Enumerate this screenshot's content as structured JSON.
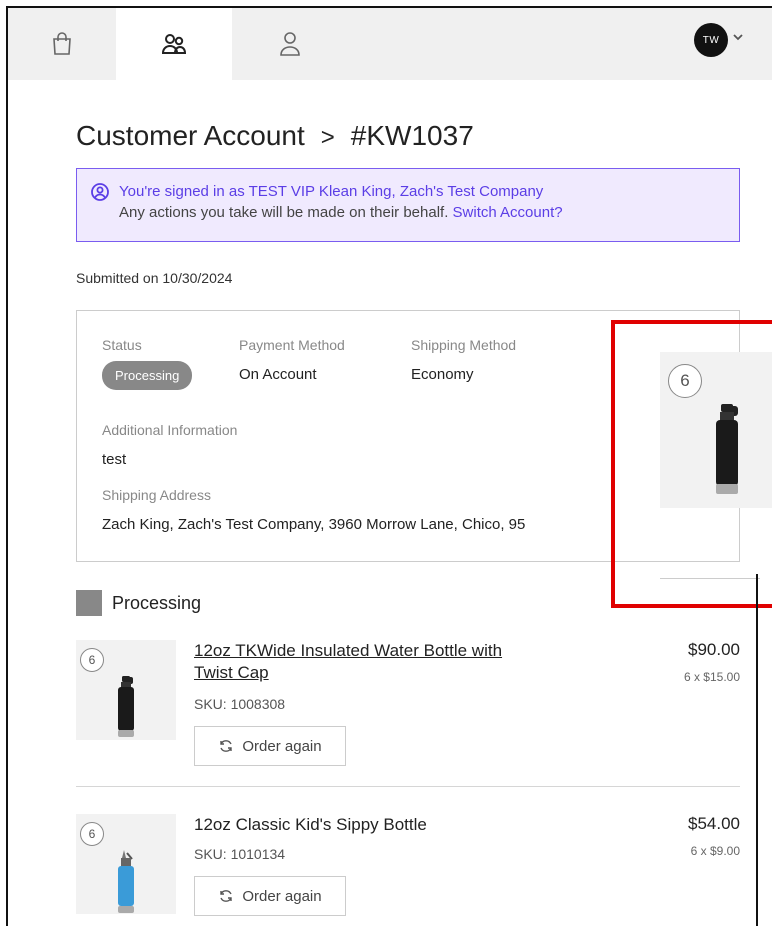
{
  "header": {
    "tabs": [
      {
        "icon": "shopping-bag-icon"
      },
      {
        "icon": "users-icon",
        "active": true
      },
      {
        "icon": "user-icon"
      }
    ],
    "avatar_initials": "TW"
  },
  "page": {
    "title": "Customer Account",
    "separator": ">",
    "order_number": "#KW1037"
  },
  "notice": {
    "line1": "You're signed in as TEST VIP Klean King, Zach's Test Company",
    "line2": "Any actions you take will be made on their behalf.",
    "link": "Switch Account?"
  },
  "order": {
    "submitted": "Submitted on 10/30/2024",
    "status_label": "Status",
    "status_value": "Processing",
    "payment_label": "Payment Method",
    "payment_value": "On Account",
    "shipping_label": "Shipping Method",
    "shipping_value": "Economy",
    "info_label": "Additional Information",
    "info_value": "test",
    "address_label": "Shipping Address",
    "address_value": "Zach King, Zach's Test Company, 3960 Morrow Lane, Chico, 95"
  },
  "highlight": {
    "badge": "6"
  },
  "section": {
    "title": "Processing"
  },
  "items": [
    {
      "qty": "6",
      "name_line1": "12oz TKWide Insulated Water Bottle with",
      "name_line2": "Twist Cap",
      "sku": "SKU: 1008308",
      "price": "$90.00",
      "unit": "6 x $15.00",
      "order_again": "Order again"
    },
    {
      "qty": "6",
      "name_line1": "12oz Classic Kid's Sippy Bottle",
      "sku": "SKU: 1010134",
      "price": "$54.00",
      "unit": "6 x $9.00",
      "order_again": "Order again"
    }
  ],
  "colors": {
    "accent": "#5b3ee6",
    "highlight": "#e00000",
    "status": "#888888"
  }
}
